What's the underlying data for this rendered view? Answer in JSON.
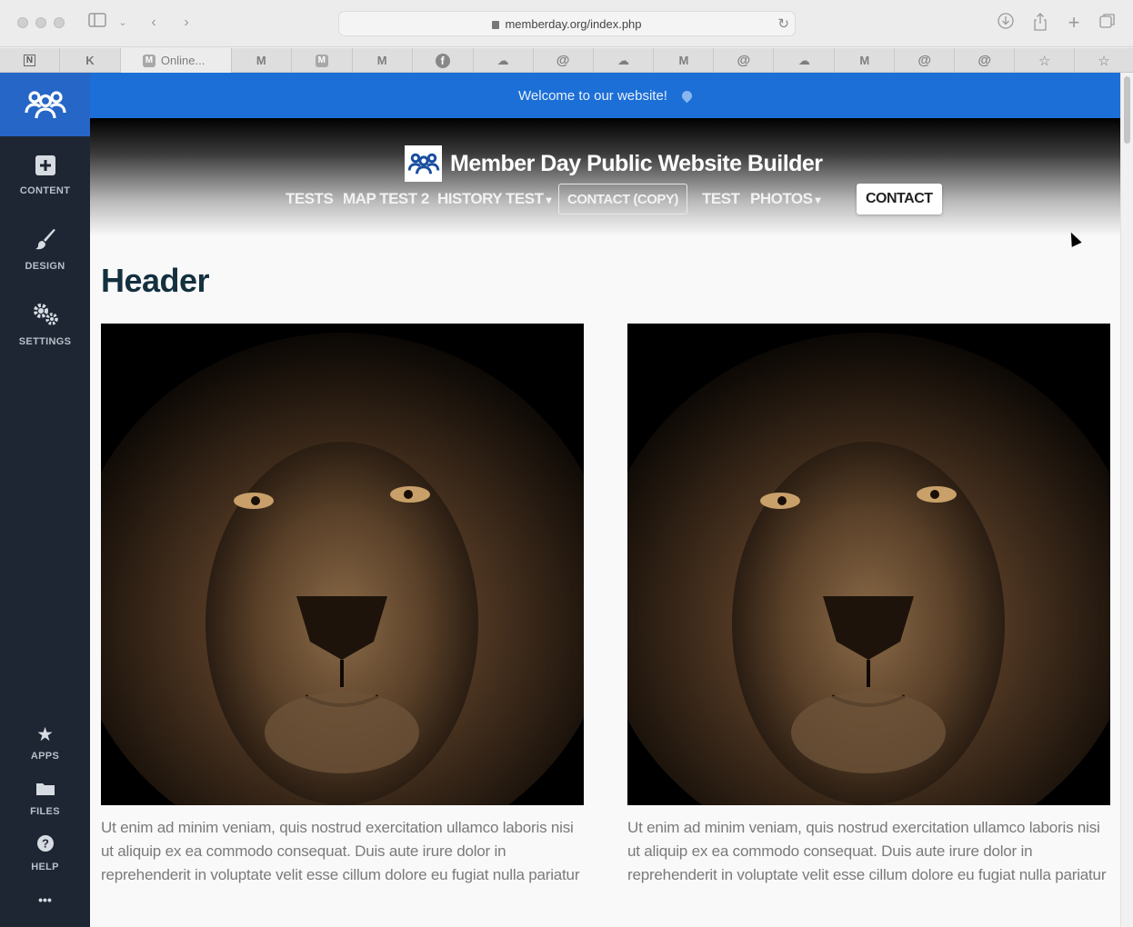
{
  "browser": {
    "url": "memberday.org/index.php",
    "tabs": [
      {
        "label": "",
        "icon": "notion-icon"
      },
      {
        "label": "",
        "icon": "k-icon"
      },
      {
        "label": "Online...",
        "icon": "m-icon"
      },
      {
        "label": "",
        "icon": "gmail-icon"
      },
      {
        "label": "",
        "icon": "m-icon"
      },
      {
        "label": "",
        "icon": "gmail-icon"
      },
      {
        "label": "",
        "icon": "facebook-icon"
      },
      {
        "label": "",
        "icon": "cloud-icon"
      },
      {
        "label": "",
        "icon": "at-icon"
      },
      {
        "label": "",
        "icon": "cloud-icon"
      },
      {
        "label": "",
        "icon": "gmail-icon"
      },
      {
        "label": "",
        "icon": "at-icon"
      },
      {
        "label": "",
        "icon": "cloud-icon"
      },
      {
        "label": "",
        "icon": "gmail-icon"
      },
      {
        "label": "",
        "icon": "at-icon"
      },
      {
        "label": "",
        "icon": "at-icon"
      },
      {
        "label": "",
        "icon": "star-icon"
      },
      {
        "label": "",
        "icon": "star-icon"
      }
    ]
  },
  "sidebar": {
    "items": [
      {
        "label": "CONTENT",
        "icon": "plus-square-icon"
      },
      {
        "label": "DESIGN",
        "icon": "brush-icon"
      },
      {
        "label": "SETTINGS",
        "icon": "gears-icon"
      },
      {
        "label": "APPS",
        "icon": "star-icon"
      },
      {
        "label": "FILES",
        "icon": "folder-icon"
      },
      {
        "label": "HELP",
        "icon": "question-icon"
      }
    ],
    "more": "•••"
  },
  "site": {
    "welcome": "Welcome to our website!",
    "title": "Member Day Public Website Builder",
    "nav": [
      "TESTS",
      "MAP TEST 2",
      "HISTORY TEST",
      "CONTACT (COPY)",
      "TEST",
      "PHOTOS",
      "CONTACT"
    ],
    "header": "Header",
    "cards": [
      {
        "text": "Ut enim ad minim veniam, quis nostrud exercitation ullamco laboris nisi ut aliquip ex ea commodo consequat. Duis aute irure dolor in reprehenderit in voluptate velit esse cillum dolore eu fugiat nulla pariatur"
      },
      {
        "text": "Ut enim ad minim veniam, quis nostrud exercitation ullamco laboris nisi ut aliquip ex ea commodo consequat. Duis aute irure dolor in reprehenderit in voluptate velit esse cillum dolore eu fugiat nulla pariatur"
      }
    ]
  },
  "colors": {
    "welcome_bar": "#1c6fd6",
    "sidebar": "#1e2633",
    "sidebar_logo": "#2566c7",
    "header_text": "#14303f"
  }
}
